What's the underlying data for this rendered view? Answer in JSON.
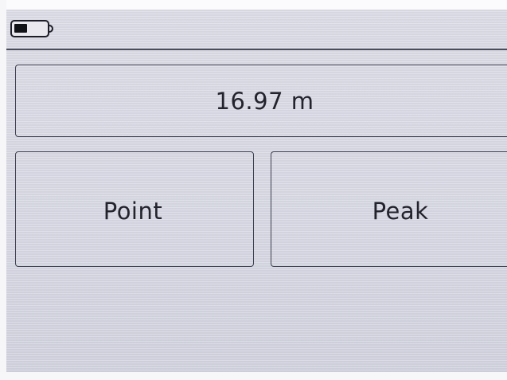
{
  "status": {
    "battery_icon": "battery-icon",
    "battery_level": 0.4
  },
  "measurement": {
    "value": "16.97 m"
  },
  "modes": {
    "point_label": "Point",
    "peak_label": "Peak"
  },
  "colors": {
    "screen_background": "#d9dae4",
    "outline": "#3f4150",
    "text": "#22232c"
  }
}
